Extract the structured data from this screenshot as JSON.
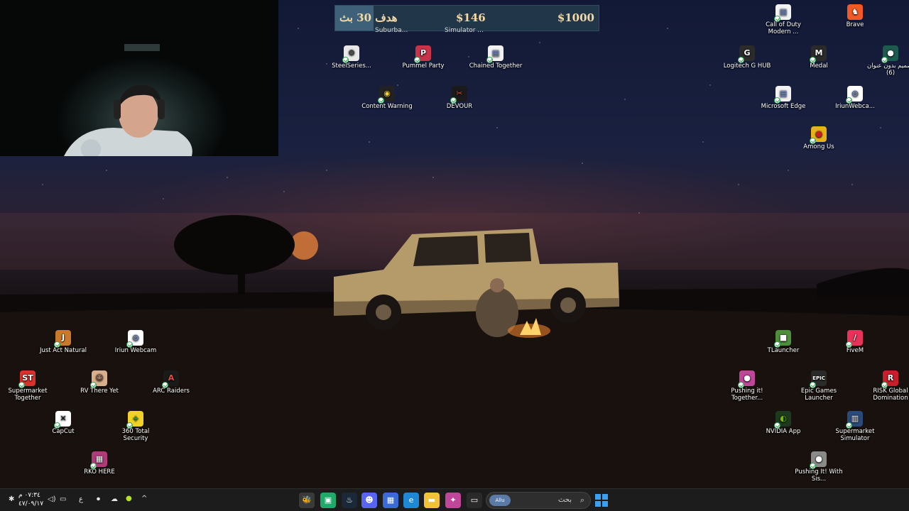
{
  "donation_bar": {
    "goal_label": "هدف 30 بث",
    "current_amount": "$146",
    "target_amount": "$1000",
    "progress_fraction": 0.146
  },
  "partial_labels": {
    "left": "Suburba...",
    "right": "Simulator ..."
  },
  "desktop_icons": [
    {
      "id": "steelseries",
      "label": "SteelSeries...",
      "icon": "steelseries-icon",
      "color": "#e8e8e8",
      "glyph": "⚙",
      "fg": "#333"
    },
    {
      "id": "pummel-party",
      "label": "Pummel Party",
      "icon": "pummel-party-icon",
      "color": "#c8334a",
      "glyph": "P"
    },
    {
      "id": "chained-together",
      "label": "Chained Together",
      "icon": "file-shortcut-icon",
      "color": "#f2f2f2",
      "glyph": "▤",
      "fg": "#6b8fd6"
    },
    {
      "id": "content-warning",
      "label": "Content Warning",
      "icon": "content-warning-icon",
      "color": "#222222",
      "glyph": "◉",
      "fg": "#f2d12f"
    },
    {
      "id": "devour",
      "label": "DEVOUR",
      "icon": "devour-icon",
      "color": "#1a1a1a",
      "glyph": "✂",
      "fg": "#e0512a"
    },
    {
      "id": "call-of-duty",
      "label": "Call of Duty Modern ...",
      "icon": "file-shortcut-icon",
      "color": "#f2f2f2",
      "glyph": "▤",
      "fg": "#6b8fd6"
    },
    {
      "id": "brave",
      "label": "Brave",
      "icon": "brave-icon",
      "color": "#f15a24",
      "glyph": "♞"
    },
    {
      "id": "logitech",
      "label": "Logitech G HUB",
      "icon": "logitech-icon",
      "color": "#2b2b2b",
      "glyph": "G"
    },
    {
      "id": "medal",
      "label": "Medal",
      "icon": "medal-icon",
      "color": "#2b2b2b",
      "glyph": "M"
    },
    {
      "id": "design-untitled",
      "label": "تصميم بدون عنوان (6)",
      "icon": "canva-file-icon",
      "color": "#1e5b4f",
      "glyph": "●"
    },
    {
      "id": "microsoft-edge",
      "label": "Microsoft Edge",
      "icon": "file-shortcut-icon",
      "color": "#f2f2f2",
      "glyph": "▤",
      "fg": "#6b8fd6"
    },
    {
      "id": "iriun-webcam-top",
      "label": "IriunWebca...",
      "icon": "iriun-webcam-icon",
      "color": "#ffffff",
      "glyph": "◎",
      "fg": "#1a3c8c"
    },
    {
      "id": "among-us",
      "label": "Among Us",
      "icon": "among-us-icon",
      "color": "#e8b21a",
      "glyph": "●",
      "fg": "#c81f1f"
    },
    {
      "id": "just-act-natural",
      "label": "Just Act Natural",
      "icon": "just-act-natural-icon",
      "color": "#c9792c",
      "glyph": "J"
    },
    {
      "id": "iriun-webcam",
      "label": "Iriun Webcam",
      "icon": "iriun-webcam-icon",
      "color": "#ffffff",
      "glyph": "◎",
      "fg": "#1a3c8c"
    },
    {
      "id": "supermarket-together",
      "label": "Supermarket Together",
      "icon": "supermarket-together-icon",
      "color": "#d8322a",
      "glyph": "ST"
    },
    {
      "id": "rv-there-yet",
      "label": "RV There Yet",
      "icon": "rv-there-yet-icon",
      "color": "#d8b08c",
      "glyph": "☺",
      "fg": "#5b3a2a"
    },
    {
      "id": "arc-raiders",
      "label": "ARC Raiders",
      "icon": "arc-raiders-icon",
      "color": "#1a1a1a",
      "glyph": "A",
      "fg": "#e24a3a"
    },
    {
      "id": "capcut",
      "label": "CapCut",
      "icon": "capcut-icon",
      "color": "#ffffff",
      "glyph": "✕",
      "fg": "#111"
    },
    {
      "id": "360-total-security",
      "label": "360 Total Security",
      "icon": "360-total-security-icon",
      "color": "#f2d024",
      "glyph": "+",
      "fg": "#2e9e4f"
    },
    {
      "id": "rko-here",
      "label": "RKO HERE",
      "icon": "folder-archive-icon",
      "color": "#b03a7a",
      "glyph": "▦"
    },
    {
      "id": "tlauncher",
      "label": "TLauncher",
      "icon": "tlauncher-icon",
      "color": "#4d8f3a",
      "glyph": "■"
    },
    {
      "id": "fivem",
      "label": "FiveM",
      "icon": "fivem-icon",
      "color": "#e8325a",
      "glyph": "/"
    },
    {
      "id": "pushing-it-together",
      "label": "Pushing it! Together...",
      "icon": "pushing-it-icon",
      "color": "#c0469a",
      "glyph": "●"
    },
    {
      "id": "epic-games",
      "label": "Epic Games Launcher",
      "icon": "epic-games-icon",
      "color": "#2a2a2a",
      "glyph": "EPIC"
    },
    {
      "id": "risk-global",
      "label": "RISK Global Domination",
      "icon": "risk-icon",
      "color": "#c81f2a",
      "glyph": "R"
    },
    {
      "id": "nvidia-app",
      "label": "NVIDIA App",
      "icon": "nvidia-icon",
      "color": "#1e3a1e",
      "glyph": "◐",
      "fg": "#76b900"
    },
    {
      "id": "supermarket-simulator",
      "label": "Supermarket Simulator",
      "icon": "supermarket-simulator-icon",
      "color": "#2a4a7a",
      "glyph": "▥"
    },
    {
      "id": "pushing-it-with-sis",
      "label": "Pushing It! With Sis...",
      "icon": "pushing-it-icon",
      "color": "#8a8a8a",
      "glyph": "●"
    }
  ],
  "taskbar": {
    "search_placeholder": "بحث",
    "search_badge": "Allu",
    "apps": [
      {
        "id": "minecraft-bee",
        "icon": "bee-app-icon",
        "color": "#3a3a3a",
        "glyph": "🐝"
      },
      {
        "id": "tlauncher-tb",
        "icon": "green-app-icon",
        "color": "#1faa6a",
        "glyph": "▣"
      },
      {
        "id": "steam",
        "icon": "steam-icon",
        "color": "#1b2838",
        "glyph": "♨"
      },
      {
        "id": "discord",
        "icon": "discord-icon",
        "color": "#5865f2",
        "glyph": "☻"
      },
      {
        "id": "store",
        "icon": "store-icon",
        "color": "#3a6bd6",
        "glyph": "▦"
      },
      {
        "id": "edge",
        "icon": "edge-icon",
        "color": "#1e88d6",
        "glyph": "e"
      },
      {
        "id": "file-explorer",
        "icon": "folder-icon",
        "color": "#f2c23a",
        "glyph": "▬"
      },
      {
        "id": "multicolor-app",
        "icon": "multicolor-app-icon",
        "color": "#c0469a",
        "glyph": "✦"
      },
      {
        "id": "task-view",
        "icon": "task-view-icon",
        "color": "#2a2a2a",
        "glyph": "▭"
      }
    ],
    "tray": {
      "lang": "ع",
      "clock_time": "٠٧:٣٤ م",
      "clock_date": "٤٧/٠٩/١٧"
    }
  }
}
